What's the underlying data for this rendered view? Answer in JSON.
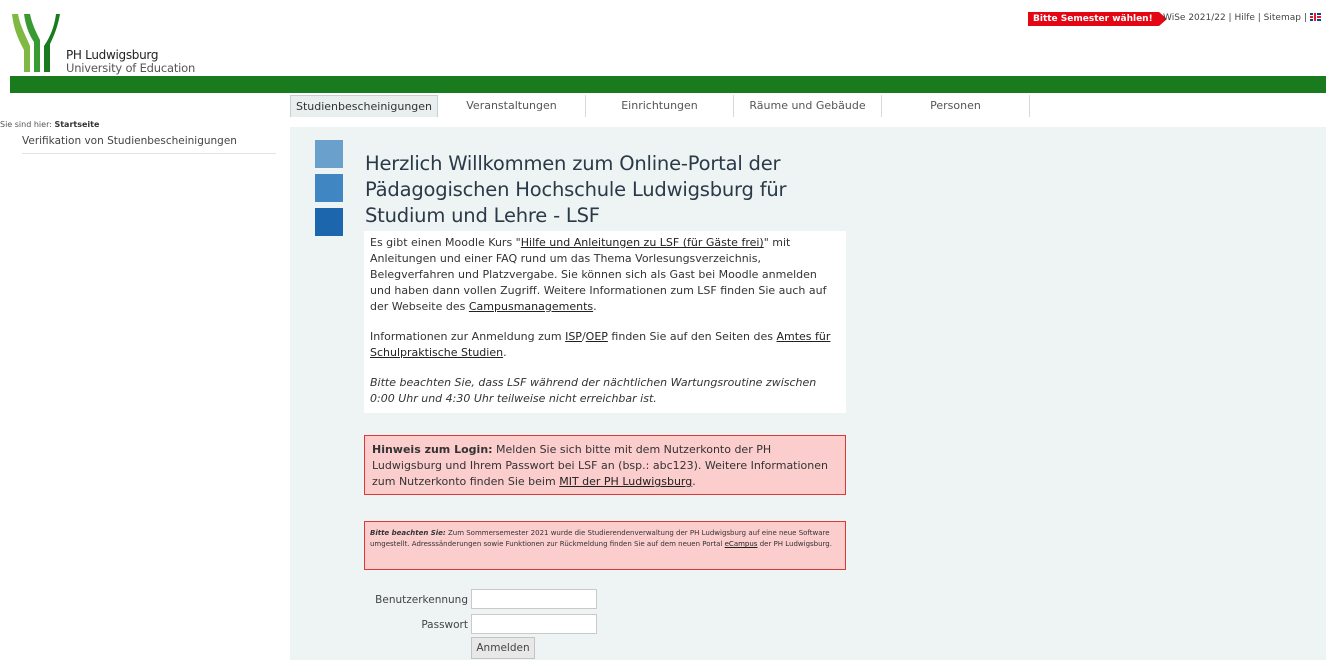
{
  "header": {
    "logo_line1": "PH Ludwigsburg",
    "logo_line2": "University of Education",
    "semester_badge": "Bitte Semester wählen!",
    "top_links": "WiSe 2021/22 | Hilfe | Sitemap |",
    "colors": {
      "green": "#1a7a1e",
      "badge_red": "#e30613"
    }
  },
  "tabs": [
    {
      "label": "Studienbescheinigungen"
    },
    {
      "label": "Veranstaltungen"
    },
    {
      "label": "Einrichtungen"
    },
    {
      "label": "Räume und Gebäude"
    },
    {
      "label": "Personen"
    }
  ],
  "breadcrumb": {
    "prefix": "Sie sind hier:",
    "current": "Startseite"
  },
  "sidebar": {
    "link": "Verifikation von Studienbescheinigungen"
  },
  "main": {
    "title": "Herzlich Willkommen zum Online-Portal der Pädagogischen Hochschule Ludwigsburg für Studium und Lehre - LSF",
    "intro1_a": "Es gibt einen Moodle Kurs \"",
    "intro1_link1": "Hilfe und Anleitungen zu LSF (für Gäste frei)",
    "intro1_b": "\" mit Anleitungen und einer FAQ rund um das Thema Vorlesungsverzeichnis, Belegverfahren und Platzvergabe. Sie können sich als Gast bei Moodle anmelden und haben dann vollen Zugriff. Weitere Informationen zum LSF finden Sie auch auf der Webseite des ",
    "intro1_link2": "Campusmanagements",
    "intro1_c": ".",
    "intro2_a": "Informationen zur Anmeldung zum ",
    "intro2_link1": "ISP",
    "intro2_sep": "/",
    "intro2_link2": "OEP",
    "intro2_b": " finden Sie auf den Seiten des ",
    "intro2_link3": "Amtes für Schulpraktische Studien",
    "intro2_c": ".",
    "intro3": "Bitte beachten Sie, dass LSF während der nächtlichen Wartungsroutine zwischen 0:00 Uhr und 4:30 Uhr teilweise nicht erreichbar ist.",
    "login_note_bold": "Hinweis zum Login:",
    "login_note_text": " Melden Sie sich bitte mit dem Nutzerkonto der PH Ludwigsburg und Ihrem Passwort bei LSF an (bsp.: abc123). Weitere Informationen zum Nutzerkonto finden Sie beim ",
    "login_note_link": "MIT der PH Ludwigsburg",
    "login_note_end": ".",
    "sem_note_bold": "Bitte beachten Sie:",
    "sem_note_text": " Zum Sommersemester 2021 wurde die Studierendenverwaltung der PH Ludwigsburg auf eine neue Software umgestellt. Adresssänderungen sowie Funktionen zur Rückmeldung finden Sie auf dem neuen Portal ",
    "sem_note_link": "eCampus",
    "sem_note_end": " der PH Ludwigsburg."
  },
  "form": {
    "user_label": "Benutzerkennung",
    "user_value": "",
    "pass_label": "Passwort",
    "pass_value": "",
    "submit_label": "Anmelden"
  }
}
